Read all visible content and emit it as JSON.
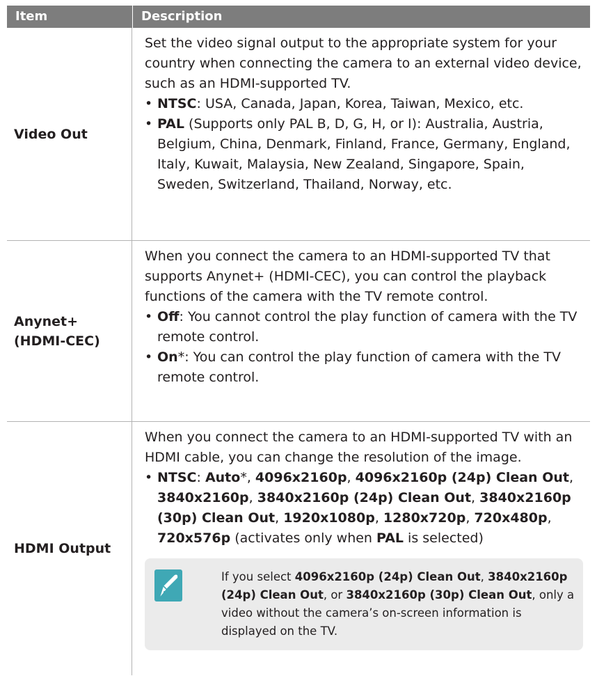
{
  "header": {
    "col_item": "Item",
    "col_desc": "Description"
  },
  "rows": [
    {
      "item": "Video Out",
      "intro": "Set the video signal output to the appropriate system for your country when connecting the camera to an external video device, such as an HDMI-supported TV.",
      "bullets": [
        {
          "bold": "NTSC",
          "text": ": USA, Canada, Japan, Korea, Taiwan, Mexico, etc."
        },
        {
          "bold": "PAL",
          "text": " (Supports only PAL B, D, G, H, or I): Australia, Austria, Belgium, China, Denmark, Finland, France, Germany, England, Italy, Kuwait, Malaysia, New Zealand, Singapore, Spain, Sweden, Switzerland, Thailand, Norway, etc."
        }
      ]
    },
    {
      "item_line1": "Anynet+",
      "item_line2": "(HDMI-CEC)",
      "intro": "When you connect the camera to an HDMI-supported TV that supports Anynet+ (HDMI-CEC), you can control the playback functions of the camera with the TV remote control.",
      "bullets": [
        {
          "bold": "Off",
          "text": ": You cannot control the play function of camera with the TV remote control."
        },
        {
          "bold": "On",
          "text": "*: You can control the play function of camera with the TV remote control."
        }
      ]
    },
    {
      "item": "HDMI Output",
      "intro": "When you connect the camera to an HDMI-supported TV with an HDMI cable, you can change the resolution of the image.",
      "bullet": {
        "ntsc": "NTSC",
        "colon": ": ",
        "auto": "Auto",
        "auto_suffix": "*, ",
        "r1": "4096x2160p",
        "sep1": ", ",
        "r2": "4096x2160p (24p) Clean Out",
        "sep2": ", ",
        "r3": "3840x2160p",
        "sep3": ", ",
        "r4": "3840x2160p (24p) Clean Out",
        "sep4": ", ",
        "r5": "3840x2160p (30p) Clean Out",
        "sep5": ", ",
        "r6": "1920x1080p",
        "sep6": ", ",
        "r7": "1280x720p",
        "sep7": ", ",
        "r8": "720x480p",
        "sep8": ", ",
        "r9": "720x576p",
        "tail1": " (activates only when ",
        "pal": "PAL",
        "tail2": " is selected)"
      },
      "note": {
        "icon": "pen-note-icon",
        "t1": "If you select ",
        "b1": "4096x2160p (24p) Clean Out",
        "t2": ", ",
        "b2": "3840x2160p (24p) Clean Out",
        "t3": ", or ",
        "b3": "3840x2160p (30p) Clean Out",
        "t4": ", only a video without the camera’s on-screen information is displayed on the TV."
      }
    }
  ],
  "colors": {
    "header_bg": "#7d7d7d",
    "note_bg": "#ebebeb",
    "icon_teal": "#3fa8b5"
  }
}
